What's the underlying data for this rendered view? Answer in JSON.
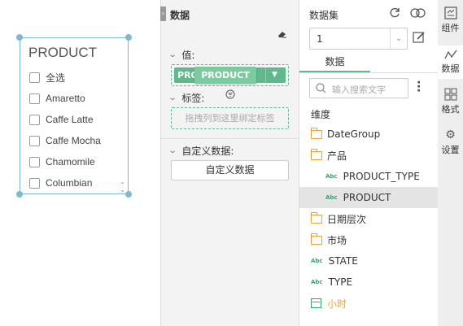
{
  "widget": {
    "title": "PRODUCT",
    "options": [
      "全选",
      "Amaretto",
      "Caffe Latte",
      "Caffe Mocha",
      "Chamomile",
      "Columbian"
    ]
  },
  "binding_panel": {
    "title": "数据",
    "value_label": "值:",
    "value_chip_partial": "PRO",
    "value_chip_drag": "PRODUCT",
    "tag_label": "标签:",
    "tag_placeholder": "拖拽列到这里绑定标签",
    "custom_label": "自定义数据:",
    "custom_button": "自定义数据"
  },
  "dataset_panel": {
    "title": "数据集",
    "selected": "1",
    "tab": "数据",
    "search_placeholder": "输入搜索文字",
    "section": "维度",
    "items": [
      {
        "label": "DateGroup",
        "type": "folder"
      },
      {
        "label": "产品",
        "type": "folder"
      },
      {
        "label": "PRODUCT_TYPE",
        "type": "text",
        "indent": true
      },
      {
        "label": "PRODUCT",
        "type": "text",
        "indent": true,
        "selected": true
      },
      {
        "label": "日期层次",
        "type": "folder"
      },
      {
        "label": "市场",
        "type": "folder"
      },
      {
        "label": "STATE",
        "type": "text"
      },
      {
        "label": "TYPE",
        "type": "text"
      },
      {
        "label": "小时",
        "type": "date",
        "highlight": true
      }
    ]
  },
  "side_tabs": [
    {
      "label": "组件",
      "icon": "component-icon"
    },
    {
      "label": "数据",
      "icon": "data-icon",
      "active": true
    },
    {
      "label": "格式",
      "icon": "format-icon"
    },
    {
      "label": "设置",
      "icon": "settings-icon"
    }
  ],
  "colors": {
    "accent": "#5fb98c",
    "folder": "#e8a33c",
    "highlight": "#e8a33c",
    "selection_border": "#7fb8cf"
  }
}
